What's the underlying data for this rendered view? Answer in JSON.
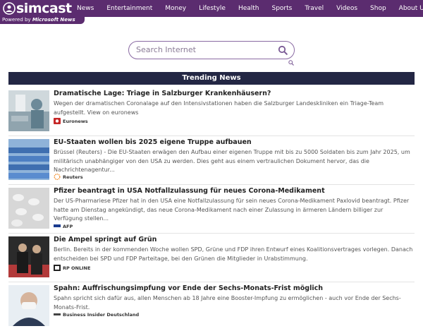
{
  "brand": {
    "name": "simcast",
    "powered": "Powered by",
    "powered_brand": "Microsoft News"
  },
  "nav": [
    "News",
    "Entertainment",
    "Money",
    "Lifestyle",
    "Health",
    "Sports",
    "Travel",
    "Videos",
    "Shop",
    "About Us"
  ],
  "search": {
    "placeholder": "Search Internet"
  },
  "trending_title": "Trending News",
  "articles": [
    {
      "title": "Dramatische Lage: Triage in Salzburger Krankenhäusern?",
      "body": "Wegen der dramatischen Coronalage auf den Intensivstationen haben die Salzburger Landeskliniken ein Triage-Team aufgestellt. View on euronews",
      "source": "Euronews",
      "source_color": "#c62828"
    },
    {
      "title": "EU-Staaten wollen bis 2025 eigene Truppe aufbauen",
      "body": "Brüssel (Reuters) - Die EU-Staaten erwägen den Aufbau einer eigenen Truppe mit bis zu 5000 Soldaten bis zum Jahr 2025, um militärisch unabhängiger von den USA zu werden. Dies geht aus einem vertraulichen Dokument hervor, das die Nachrichtenagentur...",
      "source": "Reuters",
      "source_color": "#f28c28"
    },
    {
      "title": "Pfizer beantragt in USA Notfallzulassung für neues Corona-Medikament",
      "body": "Der US-Pharmariese Pfizer hat in den USA eine Notfallzulassung für sein neues Corona-Medikament Paxlovid beantragt. Pfizer hatte am Dienstag angekündigt, das neue Corona-Medikament nach einer Zulassung in ärmeren Ländern billiger zur Verfügung stellen...",
      "source": "AFP",
      "source_color": "#1a3b8f"
    },
    {
      "title": "Die Ampel springt auf Grün",
      "body": "Berlin. Bereits in der kommenden Woche wollen SPD, Grüne und FDP ihren Entwurf eines Koalitionsvertrages vorlegen. Danach entscheiden bei SPD und FDP Parteitage, bei den Grünen die Mitglieder in Urabstimmung.",
      "source": "RP ONLINE",
      "source_color": "#222222"
    },
    {
      "title": "Spahn: Auffrischungsimpfung vor Ende der Sechs-Monats-Frist möglich",
      "body": "Spahn spricht sich dafür aus, allen Menschen ab 18 Jahre eine Booster-Impfung zu ermöglichen - auch vor Ende der Sechs-Monats-Frist.",
      "source": "Business Insider Deutschland",
      "source_color": "#444444"
    }
  ]
}
